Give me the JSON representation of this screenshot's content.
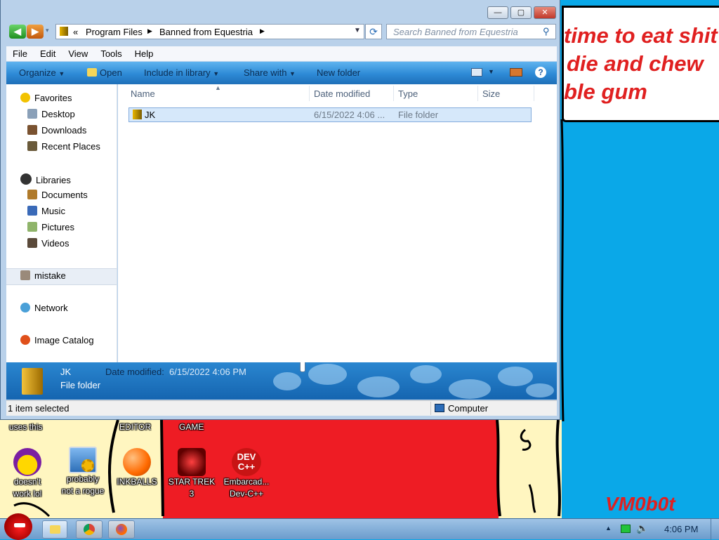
{
  "window": {
    "controls": {
      "minimize": "—",
      "maximize": "▢",
      "close": "✕"
    },
    "address": {
      "overflow": "«",
      "segments": [
        "Program Files",
        "Banned from Equestria"
      ]
    },
    "search": {
      "placeholder": "Search Banned from Equestria"
    }
  },
  "menubar": {
    "items": [
      "File",
      "Edit",
      "View",
      "Tools",
      "Help"
    ]
  },
  "toolbar": {
    "organize": "Organize",
    "open": "Open",
    "include": "Include in library",
    "share": "Share with",
    "new_folder": "New folder",
    "help": "?"
  },
  "navigation": {
    "favorites": "Favorites",
    "desktop": "Desktop",
    "downloads": "Downloads",
    "recent": "Recent Places",
    "libraries": "Libraries",
    "documents": "Documents",
    "music": "Music",
    "pictures": "Pictures",
    "videos": "Videos",
    "mistake": "mistake",
    "network": "Network",
    "image_catalog": "Image Catalog"
  },
  "columns": {
    "name": "Name",
    "date": "Date modified",
    "type": "Type",
    "size": "Size"
  },
  "files": [
    {
      "name": "JK",
      "date": "6/15/2022 4:06 ...",
      "type": "File folder",
      "size": ""
    }
  ],
  "details": {
    "name": "JK",
    "type": "File folder",
    "date_label": "Date modified:",
    "date_value": "6/15/2022 4:06 PM"
  },
  "status": {
    "selected": "1 item selected",
    "location": "Computer"
  },
  "wallpaper": {
    "speech_lines": [
      "time to eat shit",
      "die and chew",
      "ble gum"
    ],
    "signature": "VM0b0t",
    "label_uses": "uses this",
    "label_editor": "EDITOR",
    "label_game": "GAME"
  },
  "desktop_icons": [
    {
      "label1": "doesn't",
      "label2": "work lol",
      "icon": "yahoo-messenger-icon"
    },
    {
      "label1": "probably",
      "label2": "not a rogue",
      "icon": "monitor-gears-icon"
    },
    {
      "label1": "INKBALLS",
      "label2": "",
      "icon": "inkball-icon"
    },
    {
      "label1": "STAR TREK",
      "label2": "3",
      "icon": "star-wars-icon"
    },
    {
      "label1": "Embarcad...",
      "label2": "Dev-C++",
      "icon": "devcpp-icon"
    }
  ],
  "devcpp_logo": "DEV\nC++",
  "taskbar": {
    "clock": "4:06 PM",
    "tray_arrow": "▲"
  },
  "colors": {
    "accent": "#2d8ad6",
    "desktop": "#0aa8e8",
    "wall_red": "#ee1c24",
    "wall_cream": "#fff6c0"
  }
}
